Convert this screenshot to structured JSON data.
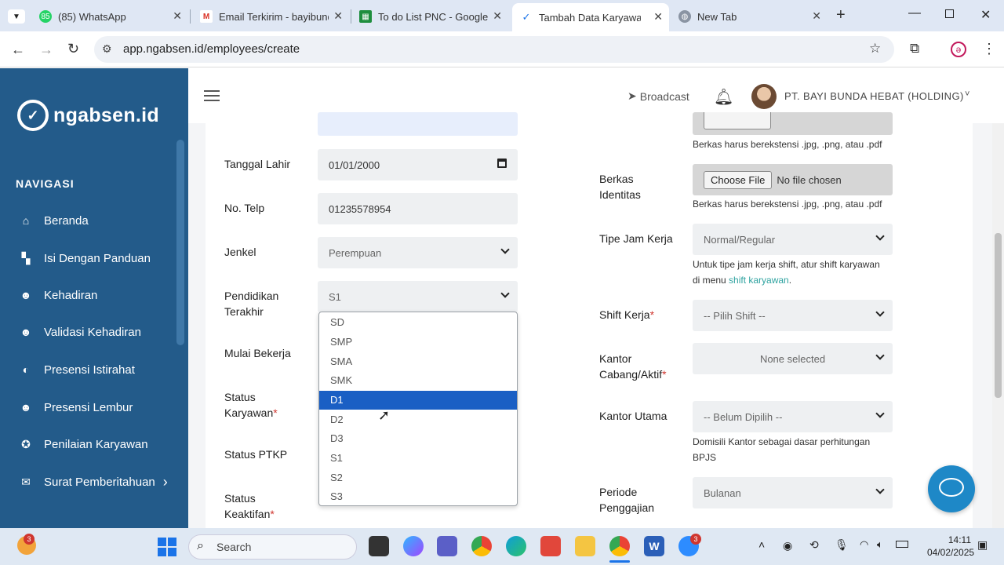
{
  "browser": {
    "tabs": [
      {
        "title": "(85) WhatsApp",
        "badge": "85"
      },
      {
        "title": "Email Terkirim - bayibunda"
      },
      {
        "title": "To do List PNC - Google"
      },
      {
        "title": "Tambah Data Karyawan -"
      },
      {
        "title": "New Tab"
      }
    ],
    "url": "app.ngabsen.id/employees/create"
  },
  "brand": {
    "logo_text": "ngabsen.id"
  },
  "sidebar": {
    "heading": "NAVIGASI",
    "items": [
      {
        "label": "Beranda",
        "icon": "home-icon"
      },
      {
        "label": "Isi Dengan Panduan",
        "icon": "grid-icon"
      },
      {
        "label": "Kehadiran",
        "icon": "user-check-icon"
      },
      {
        "label": "Validasi Kehadiran",
        "icon": "user-verify-icon"
      },
      {
        "label": "Presensi Istirahat",
        "icon": "coffee-icon"
      },
      {
        "label": "Presensi Lembur",
        "icon": "user-clock-icon"
      },
      {
        "label": "Penilaian Karyawan",
        "icon": "award-icon"
      },
      {
        "label": "Surat Pemberitahuan",
        "icon": "mail-icon",
        "chevron": "›"
      }
    ]
  },
  "topbar": {
    "broadcast": "Broadcast",
    "company": "PT. BAYI BUNDA HEBAT (HOLDING)"
  },
  "form_left": {
    "tanggal_lahir": {
      "label": "Tanggal Lahir",
      "value": "01/01/2000"
    },
    "no_telp": {
      "label": "No. Telp",
      "value": "01235578954"
    },
    "jenkel": {
      "label": "Jenkel",
      "value": "Perempuan"
    },
    "pendidikan": {
      "label_line1": "Pendidikan",
      "label_line2": "Terakhir",
      "value": "S1"
    },
    "mulai_bekerja": {
      "label": "Mulai Bekerja"
    },
    "status_karyawan": {
      "label_line1": "Status",
      "label_line2": "Karyawan",
      "req": "*"
    },
    "status_ptkp": {
      "label": "Status PTKP"
    },
    "status_keaktifan": {
      "label_line1": "Status",
      "label_line2": "Keaktifan",
      "req": "*"
    }
  },
  "dropdown": {
    "options": [
      "SD",
      "SMP",
      "SMA",
      "SMK",
      "D1",
      "D2",
      "D3",
      "S1",
      "S2",
      "S3"
    ],
    "highlighted": "D1"
  },
  "form_right": {
    "file_hint_1": "Berkas harus berekstensi .jpg, .png, atau .pdf",
    "berkas_identitas": {
      "label_line1": "Berkas",
      "label_line2": "Identitas",
      "button": "Choose File",
      "status": "No file chosen",
      "hint": "Berkas harus berekstensi .jpg, .png, atau .pdf"
    },
    "tipe_jam_kerja": {
      "label": "Tipe Jam Kerja",
      "value": "Normal/Regular",
      "help_line1": "Untuk tipe jam kerja shift, atur shift karyawan",
      "help_prefix": "di menu ",
      "help_link": "shift karyawan",
      "help_suffix": "."
    },
    "shift_kerja": {
      "label": "Shift Kerja",
      "req": "*",
      "value": "-- Pilih Shift --"
    },
    "kantor_cabang": {
      "label_line1": "Kantor",
      "label_line2": "Cabang/Aktif",
      "req": "*",
      "value": "None selected"
    },
    "kantor_utama": {
      "label": "Kantor Utama",
      "value": "-- Belum Dipilih --",
      "help_line1": "Domisili Kantor sebagai dasar perhitungan",
      "help_line2": "BPJS"
    },
    "periode": {
      "label_line1": "Periode",
      "label_line2": "Penggajian",
      "value": "Bulanan"
    }
  },
  "taskbar": {
    "search": "Search",
    "weather_badge": "3",
    "zoom_badge": "3",
    "time": "14:11",
    "date": "04/02/2025"
  },
  "colors": {
    "sidebar": "#235b8a",
    "accent": "#1a5fc4",
    "chat": "#1e88c7"
  }
}
